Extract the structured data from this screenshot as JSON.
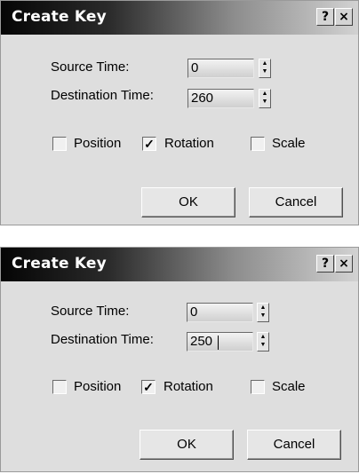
{
  "dialogs": [
    {
      "title": "Create Key",
      "help_label": "?",
      "close_label": "×",
      "source_time_label": "Source Time:",
      "source_time_value": "0",
      "destination_time_label": "Destination Time:",
      "destination_time_value": "260",
      "position_label": "Position",
      "position_checked": false,
      "rotation_label": "Rotation",
      "rotation_checked": true,
      "rotation_mark": "✓",
      "scale_label": "Scale",
      "scale_checked": false,
      "ok_label": "OK",
      "cancel_label": "Cancel"
    },
    {
      "title": "Create Key",
      "help_label": "?",
      "close_label": "×",
      "source_time_label": "Source Time:",
      "source_time_value": "0",
      "destination_time_label": "Destination Time:",
      "destination_time_value": "250",
      "position_label": "Position",
      "position_checked": false,
      "rotation_label": "Rotation",
      "rotation_checked": true,
      "rotation_mark": "✓",
      "scale_label": "Scale",
      "scale_checked": false,
      "ok_label": "OK",
      "cancel_label": "Cancel"
    }
  ]
}
